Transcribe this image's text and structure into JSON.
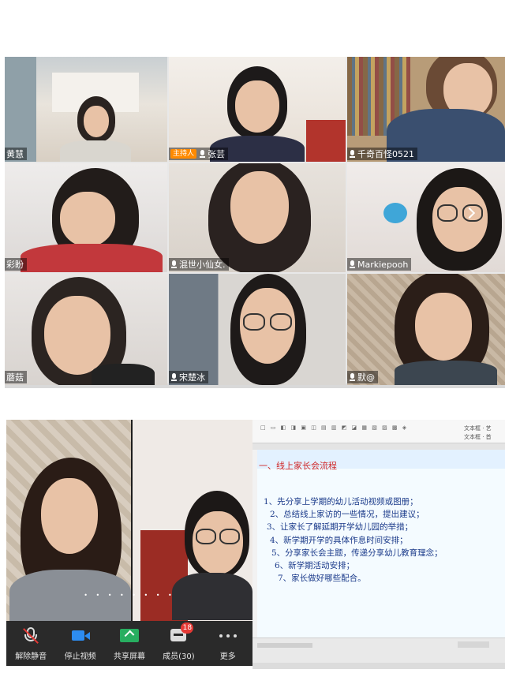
{
  "participants": [
    {
      "name": "黄慧",
      "host": false
    },
    {
      "name": "张芸",
      "host": true
    },
    {
      "name": "千奇百怪0521",
      "host": false
    },
    {
      "name": "彩盼",
      "host": false
    },
    {
      "name": "混世小仙女.",
      "host": false
    },
    {
      "name": "Markiepooh",
      "host": false
    },
    {
      "name": "蘑菇",
      "host": false
    },
    {
      "name": "宋楚冰",
      "host": false
    },
    {
      "name": "默@",
      "host": false
    }
  ],
  "host_label": "主持人",
  "toolbar": {
    "unmute": "解除静音",
    "stop_video": "停止视频",
    "share_screen": "共享屏幕",
    "members": "成员(30)",
    "members_badge": "18",
    "more": "更多"
  },
  "document": {
    "title": "一、线上家长会流程",
    "items": [
      "1、先分享上学期的幼儿活动视频或图册；",
      "2、总结线上家访的一些情况，提出建议；",
      "3、让家长了解延期开学幼儿园的举措；",
      "4、新学期开学的具体作息时间安排；",
      "5、分享家长会主题，传递分享幼儿教育理念；",
      "6、新学期活动安排；",
      "7、家长做好哪些配合。"
    ],
    "ribbon_right_1": "文本框 · 艺",
    "ribbon_right_2": "文本框 · 首"
  },
  "colors": {
    "toolbar_bg": "#2a2a2a",
    "video_icon": "#2d8cf0",
    "share_icon": "#27ae60",
    "badge": "#e53935",
    "doc_title": "#d02a2a",
    "doc_text": "#1a3a8a",
    "host_badge": "#ff8a00"
  }
}
